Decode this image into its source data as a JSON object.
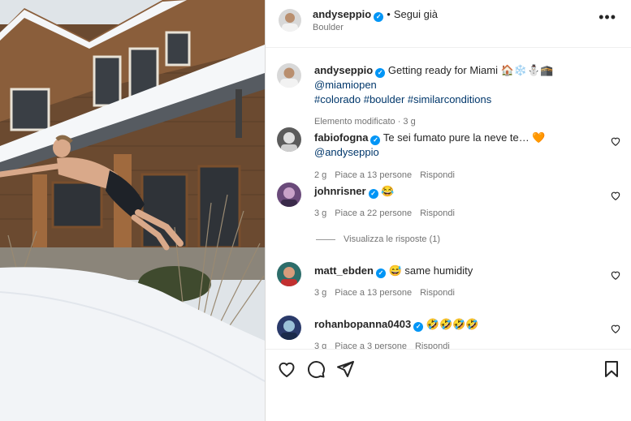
{
  "post": {
    "username": "andyseppio",
    "follow_label": "Segui già",
    "location": "Boulder",
    "menu_label": "•••"
  },
  "caption": {
    "username": "andyseppio",
    "text": "Getting ready for Miami 🏠❄️⛄🕋",
    "mention": "@miamiopen",
    "hashtags": "#colorado #boulder #similarconditions",
    "edited": "Elemento modificato · 3 g"
  },
  "comments": [
    {
      "username": "fabiofogna",
      "text": "Te sei fumato pure la neve te… 🧡",
      "mention": "@andyseppio",
      "time": "2 g",
      "likes": "Piace a 13 persone",
      "reply": "Rispondi"
    },
    {
      "username": "johnrisner",
      "text": "😂",
      "time": "3 g",
      "likes": "Piace a 22 persone",
      "reply": "Rispondi"
    },
    {
      "username": "matt_ebden",
      "text": "😅 same humidity",
      "time": "3 g",
      "likes": "Piace a 13 persone",
      "reply": "Rispondi"
    },
    {
      "username": "rohanbopanna0403",
      "text": "🤣🤣🤣🤣",
      "time": "3 g",
      "likes": "Piace a 3 persone",
      "reply": "Rispondi"
    }
  ],
  "view_replies": "Visualizza le risposte (1)",
  "colors": {
    "verified": "#0095f6",
    "link": "#00376b",
    "muted": "#737373"
  },
  "icons": [
    "heart-icon",
    "comment-icon",
    "share-icon",
    "bookmark-icon",
    "verified-icon",
    "more-icon"
  ]
}
